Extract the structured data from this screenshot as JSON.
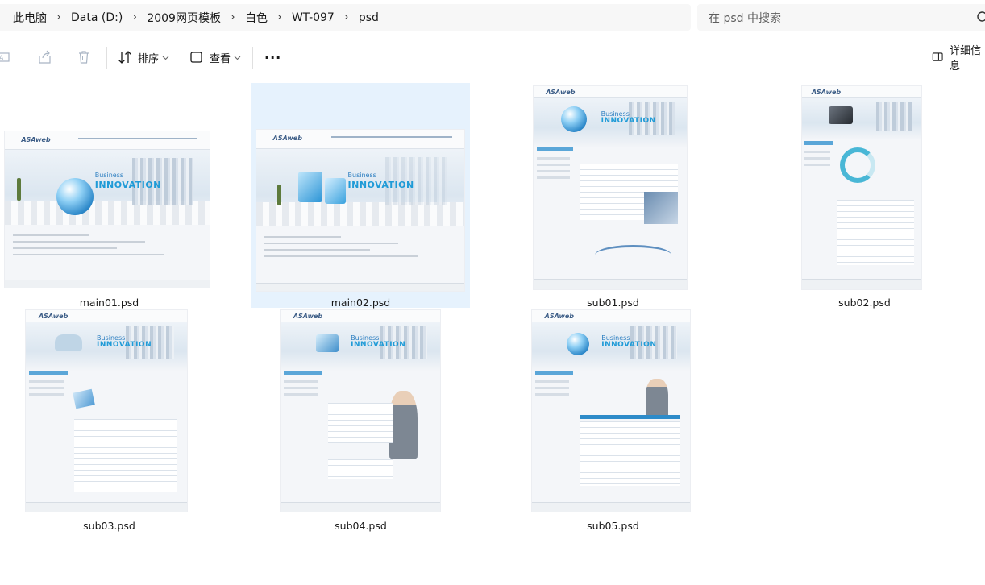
{
  "breadcrumb": {
    "items": [
      "此电脑",
      "Data (D:)",
      "2009网页模板",
      "白色",
      "WT-097",
      "psd"
    ]
  },
  "search": {
    "placeholder": "在 psd 中搜索"
  },
  "toolbar": {
    "sort_label": "排序",
    "view_label": "查看",
    "more_label": "···",
    "details_label": "详细信息"
  },
  "files": [
    {
      "name": "main01.psd",
      "selected": false
    },
    {
      "name": "main02.psd",
      "selected": true
    },
    {
      "name": "sub01.psd",
      "selected": false
    },
    {
      "name": "sub02.psd",
      "selected": false
    },
    {
      "name": "sub03.psd",
      "selected": false
    },
    {
      "name": "sub04.psd",
      "selected": false
    },
    {
      "name": "sub05.psd",
      "selected": false
    }
  ],
  "thumbnails": {
    "logo": "ASAweb",
    "banner_line1": "Business",
    "banner_line2": "INNOVATION"
  },
  "colors": {
    "selection": "#e6f2fd",
    "accent": "#1f9bd7",
    "addr_bg": "#f7f7f7"
  }
}
